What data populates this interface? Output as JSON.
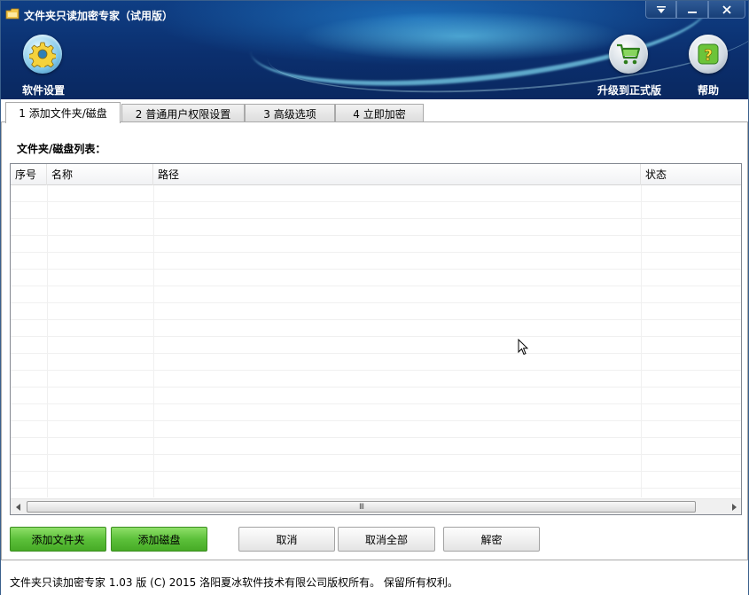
{
  "window": {
    "title": "文件夹只读加密专家（试用版）",
    "controls": {
      "menu": "▼",
      "minimize": "—",
      "close": "✕"
    }
  },
  "header": {
    "settings_label": "软件设置",
    "upgrade_label": "升级到正式版",
    "help_label": "帮助",
    "icons": {
      "settings": "gear-icon",
      "upgrade": "cart-icon",
      "help": "help-icon"
    },
    "colors": {
      "bg": "#0b2f6e",
      "accent": "#8eeaff"
    }
  },
  "tabs": [
    {
      "label": "1 添加文件夹/磁盘",
      "active": true
    },
    {
      "label": "2 普通用户权限设置",
      "active": false
    },
    {
      "label": "3 高级选项",
      "active": false
    },
    {
      "label": "4 立即加密",
      "active": false
    }
  ],
  "main": {
    "list_label": "文件夹/磁盘列表：",
    "columns": [
      "序号",
      "名称",
      "路径",
      "状态"
    ],
    "rows": []
  },
  "scrollbar": {
    "grip": "III"
  },
  "buttons": {
    "add_folder": "添加文件夹",
    "add_disk": "添加磁盘",
    "cancel": "取消",
    "cancel_all": "取消全部",
    "decrypt": "解密",
    "colors": {
      "green": "#5cc03a",
      "gray": "#e4e4e4"
    }
  },
  "status": {
    "copyright": "文件夹只读加密专家 1.03 版 (C) 2015 洛阳夏冰软件技术有限公司版权所有。 保留所有权利。"
  }
}
